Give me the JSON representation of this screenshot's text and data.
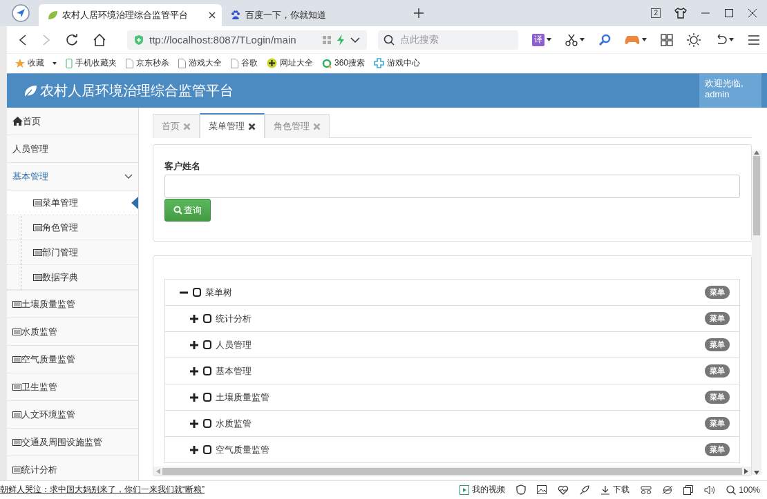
{
  "browser": {
    "tabs": [
      {
        "title": "农村人居环境治理综合监管平台",
        "selected": true
      },
      {
        "title": "百度一下，你就知道",
        "selected": false
      }
    ],
    "tab_count": "2",
    "address": "ttp://localhost:8087/TLogin/main",
    "search": {
      "placeholder": "点此搜索"
    },
    "translate_glyph": "译",
    "bookmarks": [
      {
        "label": "收藏"
      },
      {
        "label": "手机收藏夹"
      },
      {
        "label": "京东秒杀"
      },
      {
        "label": "游戏大全"
      },
      {
        "label": "谷歌"
      },
      {
        "label": "网址大全"
      },
      {
        "label": "360搜索"
      },
      {
        "label": "游戏中心"
      }
    ]
  },
  "header": {
    "title": "农村人居环境治理综合监管平台",
    "welcome": "欢迎光临,",
    "user": "admin"
  },
  "sidebar": {
    "items": [
      {
        "label": "首页",
        "kind": "home"
      },
      {
        "label": "人员管理",
        "kind": "plain"
      },
      {
        "label": "基本管理",
        "kind": "group",
        "expanded": true,
        "children": [
          {
            "label": "菜单管理",
            "selected": true
          },
          {
            "label": "角色管理",
            "selected": false
          },
          {
            "label": "部门管理",
            "selected": false
          },
          {
            "label": "数据字典",
            "selected": false
          }
        ]
      },
      {
        "label": "土壤质量监管",
        "kind": "card"
      },
      {
        "label": "水质监管",
        "kind": "card"
      },
      {
        "label": "空气质量监管",
        "kind": "card"
      },
      {
        "label": "卫生监管",
        "kind": "card"
      },
      {
        "label": "人文环境监管",
        "kind": "card"
      },
      {
        "label": "交通及周围设施监管",
        "kind": "card"
      },
      {
        "label": "统计分析",
        "kind": "card"
      }
    ]
  },
  "tabs": [
    {
      "label": "首页",
      "selected": false
    },
    {
      "label": "菜单管理",
      "selected": true
    },
    {
      "label": "角色管理",
      "selected": false
    }
  ],
  "search_form": {
    "label": "客户姓名",
    "button": "查询"
  },
  "tree": {
    "label": "菜单树",
    "expanded": true,
    "badge": "菜单",
    "children": [
      {
        "label": "统计分析",
        "expanded": false,
        "badge": "菜单"
      },
      {
        "label": "人员管理",
        "expanded": false,
        "badge": "菜单"
      },
      {
        "label": "基本管理",
        "expanded": false,
        "badge": "菜单"
      },
      {
        "label": "土壤质量监管",
        "expanded": false,
        "badge": "菜单"
      },
      {
        "label": "水质监管",
        "expanded": false,
        "badge": "菜单"
      },
      {
        "label": "空气质量监管",
        "expanded": false,
        "badge": "菜单"
      }
    ]
  },
  "status_bar": {
    "news": "朝鲜人哭泣：求中国大妈别来了，你们一来我们就“断粮”",
    "video": "我的视频",
    "download": "下载",
    "zoom": "100%"
  }
}
